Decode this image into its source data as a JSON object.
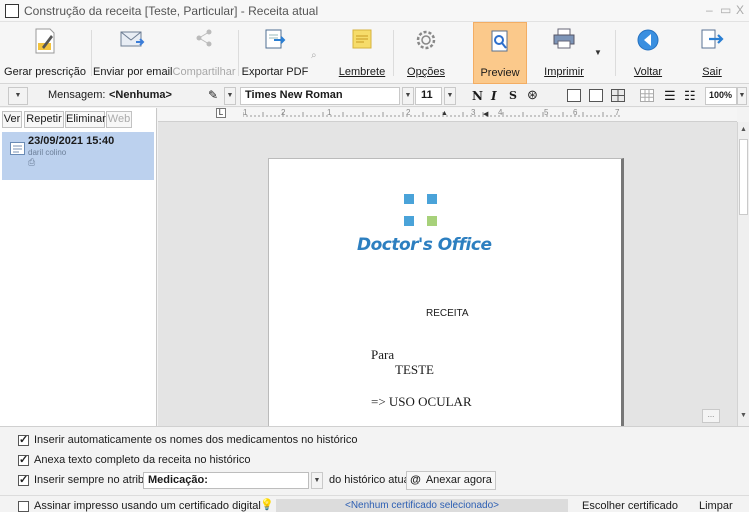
{
  "window": {
    "title": "Construção da receita [Teste, Particular] - Receita atual",
    "controls": [
      "–",
      "▭",
      "X"
    ]
  },
  "ribbon": {
    "gerar": "Gerar prescrição",
    "enviar": "Enviar por email",
    "compartilhar": "Compartilhar",
    "exportar": "Exportar PDF",
    "lembrete": "Lembrete",
    "opcoes": "Opções",
    "preview": "Preview",
    "imprimir": "Imprimir",
    "voltar": "Voltar",
    "sair": "Sair"
  },
  "format_bar": {
    "mensagem_label": "Mensagem:",
    "mensagem_value": "<Nenhuma>",
    "font_name": "Times New Roman",
    "font_size": "11",
    "bold": "N",
    "italic": "I",
    "underline": "S",
    "zoom": "100%"
  },
  "left_panel": {
    "tabs": [
      "Ver",
      "Repetir",
      "Eliminar",
      "Web"
    ],
    "history": {
      "date": "23/09/2021 15:40",
      "author": "daril colino"
    }
  },
  "ruler": {
    "marks": [
      "1",
      "2",
      "1",
      "2",
      "3",
      "4",
      "5",
      "6",
      "7"
    ]
  },
  "document": {
    "logo": "Doctor's Office",
    "heading": "RECEITA",
    "para": "Para",
    "patient": "TESTE",
    "instruction": "=> USO OCULAR"
  },
  "options": {
    "opt1": "Inserir automaticamente os nomes dos medicamentos no histórico",
    "opt2": "Anexa texto completo da receita no histórico",
    "opt3": "Inserir sempre no atributo",
    "attribute": "Medicação:",
    "from_history": "do histórico atual",
    "anexar": "Anexar agora",
    "assinar": "Assinar impresso usando um certificado digital",
    "certificate": "<Nenhum certificado selecionado>",
    "escolher": "Escolher certificado",
    "limpar": "Limpar"
  },
  "colors": {
    "preview_active": "#fbc98b",
    "history_selected": "#bcd1ee",
    "logo_blue": "#4aa3d9",
    "logo_green": "#a7d17a"
  }
}
